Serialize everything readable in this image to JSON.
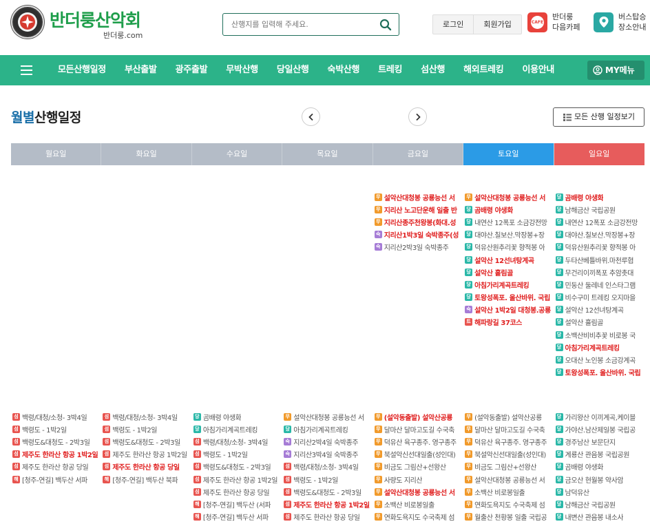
{
  "colors": {
    "brand": "#1f9e4b",
    "nav": "#2cb389",
    "hot": "#e02020",
    "sat": "#2b9be6",
    "sun": "#e75c5c"
  },
  "tags": {
    "무": "#f19a2b",
    "당": "#2ab8a8",
    "숙": "#a67cd6",
    "섬": "#e8544f",
    "트": "#e8544f",
    "해": "#e8544f"
  },
  "header": {
    "logo_title": "반더룽산악회",
    "logo_sub": "반더룽.com",
    "search_placeholder": "산행지를 입력해 주세요.",
    "login": "로그인",
    "signup": "회원가입",
    "cafe_badge": "CAFE",
    "cafe_label_1": "반더룽",
    "cafe_label_2": "다음카페",
    "bus_label_1": "버스탑승",
    "bus_label_2": "장소안내"
  },
  "nav": {
    "items": [
      "모든산행일정",
      "부산출발",
      "광주출발",
      "무박산행",
      "당일산행",
      "숙박산행",
      "트레킹",
      "섬산행",
      "해외트레킹",
      "이용안내"
    ],
    "my_menu": "MY메뉴"
  },
  "title": {
    "highlight": "월별",
    "rest": "산행일정",
    "all_button": "모든 산행 일정보기"
  },
  "weekdays": [
    "월요일",
    "화요일",
    "수요일",
    "목요일",
    "금요일",
    "토요일",
    "일요일"
  ],
  "weeks": [
    [
      [],
      [],
      [],
      [],
      [
        {
          "tag": "무",
          "text": "설악산대청봉 공룡능선 서",
          "hot": true
        },
        {
          "tag": "무",
          "text": "지리산 노고단운해 일출 반",
          "hot": true
        },
        {
          "tag": "무",
          "text": "지리산종주천왕봉(화대.성",
          "hot": true
        },
        {
          "tag": "숙",
          "text": "지리산1박3일 숙박종주(성",
          "hot": true
        },
        {
          "tag": "숙",
          "text": "지리산2박3일 숙박종주",
          "hot": false
        }
      ],
      [
        {
          "tag": "무",
          "text": "설악산대청봉 공룡능선 서",
          "hot": true
        },
        {
          "tag": "당",
          "text": "곰배령 야생화",
          "hot": true
        },
        {
          "tag": "당",
          "text": "내연산 12폭포 소금강전망",
          "hot": false
        },
        {
          "tag": "당",
          "text": "대야산.칠보산.막장봉+장",
          "hot": false
        },
        {
          "tag": "당",
          "text": "덕유산원추리꽃 향적봉 아",
          "hot": false
        },
        {
          "tag": "당",
          "text": "설악산 12선녀탕계곡",
          "hot": true
        },
        {
          "tag": "당",
          "text": "설악산 흘림골",
          "hot": true
        },
        {
          "tag": "당",
          "text": "아침가리계곡트레킹",
          "hot": true
        },
        {
          "tag": "당",
          "text": "토왕성폭포. 울산바위. 국립",
          "hot": true
        },
        {
          "tag": "숙",
          "text": "설악산 1박2일 대청봉.공룡",
          "hot": true
        },
        {
          "tag": "트",
          "text": "해파랑길 37코스",
          "hot": true
        }
      ],
      [
        {
          "tag": "당",
          "text": "곰배령 야생화",
          "hot": true
        },
        {
          "tag": "당",
          "text": "남해금산 국립공원",
          "hot": false
        },
        {
          "tag": "당",
          "text": "내연산 12폭포 소금강전망",
          "hot": false
        },
        {
          "tag": "당",
          "text": "대야산.칠보산.막장봉+장",
          "hot": false
        },
        {
          "tag": "당",
          "text": "덕유산원추리꽃 향적봉 아",
          "hot": false
        },
        {
          "tag": "당",
          "text": "두타산베틀바위.마천루협",
          "hot": false
        },
        {
          "tag": "당",
          "text": "무건리이끼폭포 추암촛대",
          "hot": false
        },
        {
          "tag": "당",
          "text": "민둥산 둘레네 인스타그램",
          "hot": false
        },
        {
          "tag": "당",
          "text": "비수구미 트레킹 오지마을",
          "hot": false
        },
        {
          "tag": "당",
          "text": "설악산 12선녀탕계곡",
          "hot": false
        },
        {
          "tag": "당",
          "text": "설악산 흘림골",
          "hot": false
        },
        {
          "tag": "당",
          "text": "소백산비비추꽃 비로봉 국",
          "hot": false
        },
        {
          "tag": "당",
          "text": "아침가리계곡트레킹",
          "hot": true
        },
        {
          "tag": "당",
          "text": "오대산 노인봉 소금강계곡",
          "hot": false
        },
        {
          "tag": "당",
          "text": "토왕성폭포. 울산바위. 국립",
          "hot": true
        }
      ]
    ],
    [
      [
        {
          "tag": "섬",
          "text": "백령/대청/소청- 3박4일",
          "hot": false
        },
        {
          "tag": "섬",
          "text": "백령도 - 1박2일",
          "hot": false
        },
        {
          "tag": "섬",
          "text": "백령도&대청도 - 2박3일",
          "hot": false
        },
        {
          "tag": "섬",
          "text": "제주도 한라산 항공 1박2일",
          "hot": true
        },
        {
          "tag": "섬",
          "text": "제주도 한라산 항공 당일",
          "hot": false
        },
        {
          "tag": "해",
          "text": "[청주-연길] 백두산 서파",
          "hot": false
        }
      ],
      [
        {
          "tag": "섬",
          "text": "백령/대청/소청- 3박4일",
          "hot": false
        },
        {
          "tag": "섬",
          "text": "백령도 - 1박2일",
          "hot": false
        },
        {
          "tag": "섬",
          "text": "백령도&대청도 - 2박3일",
          "hot": false
        },
        {
          "tag": "섬",
          "text": "제주도 한라산 항공 1박2일",
          "hot": false
        },
        {
          "tag": "섬",
          "text": "제주도 한라산 항공 당일",
          "hot": true
        },
        {
          "tag": "해",
          "text": "[청주-연길] 백두산 북파",
          "hot": false
        }
      ],
      [
        {
          "tag": "당",
          "text": "곰배령 야생화",
          "hot": false
        },
        {
          "tag": "당",
          "text": "아침가리계곡트레킹",
          "hot": false
        },
        {
          "tag": "섬",
          "text": "백령/대청/소청- 3박4일",
          "hot": false
        },
        {
          "tag": "섬",
          "text": "백령도 - 1박2일",
          "hot": false
        },
        {
          "tag": "섬",
          "text": "백령도&대청도 - 2박3일",
          "hot": false
        },
        {
          "tag": "섬",
          "text": "제주도 한라산 항공 1박2일",
          "hot": false
        },
        {
          "tag": "섬",
          "text": "제주도 한라산 항공 당일",
          "hot": false
        },
        {
          "tag": "해",
          "text": "[청주-연길] 백두산 (서파",
          "hot": false
        },
        {
          "tag": "해",
          "text": "[청주-연길] 백두산 서파",
          "hot": false
        }
      ],
      [
        {
          "tag": "무",
          "text": "설악산대청봉 공룡능선 서",
          "hot": false
        },
        {
          "tag": "당",
          "text": "아침가리계곡트레킹",
          "hot": false
        },
        {
          "tag": "숙",
          "text": "지리산2박4일 숙박종주",
          "hot": false
        },
        {
          "tag": "숙",
          "text": "지리산3박4일 숙박종주",
          "hot": false
        },
        {
          "tag": "섬",
          "text": "백령/대청/소청- 3박4일",
          "hot": false
        },
        {
          "tag": "섬",
          "text": "백령도 - 1박2일",
          "hot": false
        },
        {
          "tag": "섬",
          "text": "백령도&대청도 - 2박3일",
          "hot": false
        },
        {
          "tag": "섬",
          "text": "제주도 한라산 항공 1박2일",
          "hot": true
        },
        {
          "tag": "섬",
          "text": "제주도 한라산 항공 당일",
          "hot": false
        }
      ],
      [
        {
          "tag": "무",
          "text": "(설악동출발) 설악산공룡",
          "hot": true
        },
        {
          "tag": "무",
          "text": "달마산 달마고도길 수국축",
          "hot": false
        },
        {
          "tag": "무",
          "text": "덕유산 육구종주. 영구종주",
          "hot": false
        },
        {
          "tag": "무",
          "text": "북설악신선대일출(성인대)",
          "hot": false
        },
        {
          "tag": "무",
          "text": "비금도 그림산+선왕산",
          "hot": false
        },
        {
          "tag": "무",
          "text": "사량도 지리산",
          "hot": false
        },
        {
          "tag": "무",
          "text": "설악산대청봉 공룡능선 서",
          "hot": true
        },
        {
          "tag": "무",
          "text": "소백산 비로봉일출",
          "hot": false
        },
        {
          "tag": "무",
          "text": "연화도욕지도 수국축제 섬",
          "hot": false
        }
      ],
      [
        {
          "tag": "무",
          "text": "(설악동출발) 설악산공룡",
          "hot": false
        },
        {
          "tag": "무",
          "text": "달마산 달마고도길 수국축",
          "hot": false
        },
        {
          "tag": "무",
          "text": "덕유산 육구종주. 영구종주",
          "hot": false
        },
        {
          "tag": "무",
          "text": "북설악신선대일출(성인대)",
          "hot": false
        },
        {
          "tag": "무",
          "text": "비금도 그림산+선왕산",
          "hot": false
        },
        {
          "tag": "무",
          "text": "설악산대청봉 공룡능선 서",
          "hot": false
        },
        {
          "tag": "무",
          "text": "소백산 비로봉일출",
          "hot": false
        },
        {
          "tag": "무",
          "text": "연화도욕지도 수국축제 섬",
          "hot": false
        },
        {
          "tag": "무",
          "text": "월출산 천황봉 일출 국립공",
          "hot": false
        }
      ],
      [
        {
          "tag": "당",
          "text": "가리왕산 이끼계곡,케이블",
          "hot": false
        },
        {
          "tag": "당",
          "text": "가야산.남산제일봉 국립공",
          "hot": false
        },
        {
          "tag": "당",
          "text": "경주남산 보문단지",
          "hot": false
        },
        {
          "tag": "당",
          "text": "계룡산 관음봉 국립공원",
          "hot": false
        },
        {
          "tag": "당",
          "text": "곰배령 야생화",
          "hot": false
        },
        {
          "tag": "당",
          "text": "금오산 현월봉 약사암",
          "hot": false
        },
        {
          "tag": "당",
          "text": "남덕유산",
          "hot": false
        },
        {
          "tag": "당",
          "text": "남해금산 국립공원",
          "hot": false
        },
        {
          "tag": "당",
          "text": "내변산 관음봉 내소사",
          "hot": false
        }
      ]
    ]
  ]
}
